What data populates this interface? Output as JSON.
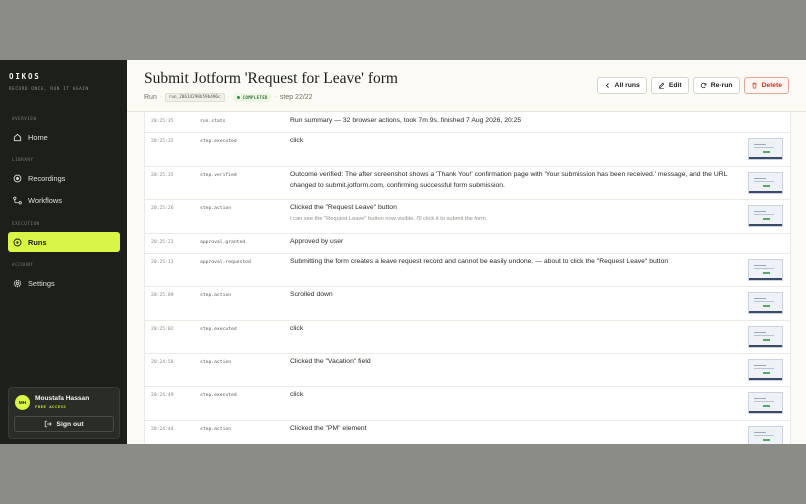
{
  "app": {
    "brand": "OIKOS",
    "tagline": "RECORD ONCE, RUN IT AGAIN"
  },
  "sidebar": {
    "sections": {
      "overview": "OVERVIEW",
      "library": "LIBRARY",
      "execution": "EXECUTION",
      "account": "ACCOUNT"
    },
    "items": [
      {
        "label": "Home",
        "icon": "home-icon"
      },
      {
        "label": "Recordings",
        "icon": "record-icon"
      },
      {
        "label": "Workflows",
        "icon": "workflow-icon"
      },
      {
        "label": "Runs",
        "icon": "play-icon",
        "active": true
      },
      {
        "label": "Settings",
        "icon": "gear-icon"
      }
    ]
  },
  "user": {
    "initials": "MH",
    "name": "Moustafa Hassan",
    "plan": "FREE ACCESS",
    "signout_label": "Sign out"
  },
  "header": {
    "title": "Submit Jotform 'Request for Leave' form",
    "run_label": "Run",
    "run_id": "run_20614290b59b496c",
    "status": "COMPLETED",
    "step": "step 22/22",
    "buttons": {
      "all_runs": "All runs",
      "edit": "Edit",
      "rerun": "Re-run",
      "delete": "Delete"
    }
  },
  "colors": {
    "accent": "#d9f547",
    "sidebar_bg": "#1d1f1b",
    "danger": "#b83a22",
    "success": "#2d9a47"
  },
  "log": [
    {
      "time": "20:25:35",
      "kind": "run.stats",
      "message": "Run summary — 32 browser actions, took 7m 9s, finished 7 Aug 2026, 20:25",
      "sub": "",
      "thumb": false
    },
    {
      "time": "20:25:35",
      "kind": "step.executed",
      "message": "click",
      "sub": "",
      "thumb": true
    },
    {
      "time": "20:25:35",
      "kind": "step.verified",
      "message": "Outcome verified: The after screenshot shows a 'Thank You!' confirmation page with 'Your submission has been received.' message, and the URL changed to submit.jotform.com, confirming successful form submission.",
      "sub": "",
      "thumb": true
    },
    {
      "time": "20:25:26",
      "kind": "step.action",
      "message": "Clicked the \"Request Leave\" button",
      "sub": "I can see the \"Request Leave\" button now visible. I'll click it to submit the form.",
      "thumb": true
    },
    {
      "time": "20:25:23",
      "kind": "approval.granted",
      "message": "Approved by user",
      "sub": "",
      "thumb": false
    },
    {
      "time": "20:25:13",
      "kind": "approval.requested",
      "message": "Submitting the form creates a leave request record and cannot be easily undone. — about to click the \"Request Leave\" button",
      "sub": "",
      "thumb": true
    },
    {
      "time": "20:25:09",
      "kind": "step.action",
      "message": "Scrolled down",
      "sub": "",
      "thumb": true
    },
    {
      "time": "20:25:02",
      "kind": "step.executed",
      "message": "click",
      "sub": "",
      "thumb": true
    },
    {
      "time": "20:24:58",
      "kind": "step.action",
      "message": "Clicked the \"Vacation\" field",
      "sub": "",
      "thumb": true
    },
    {
      "time": "20:24:49",
      "kind": "step.executed",
      "message": "click",
      "sub": "",
      "thumb": true
    },
    {
      "time": "20:24:44",
      "kind": "step.action",
      "message": "Clicked the \"PM\" element",
      "sub": "",
      "thumb": true
    }
  ]
}
